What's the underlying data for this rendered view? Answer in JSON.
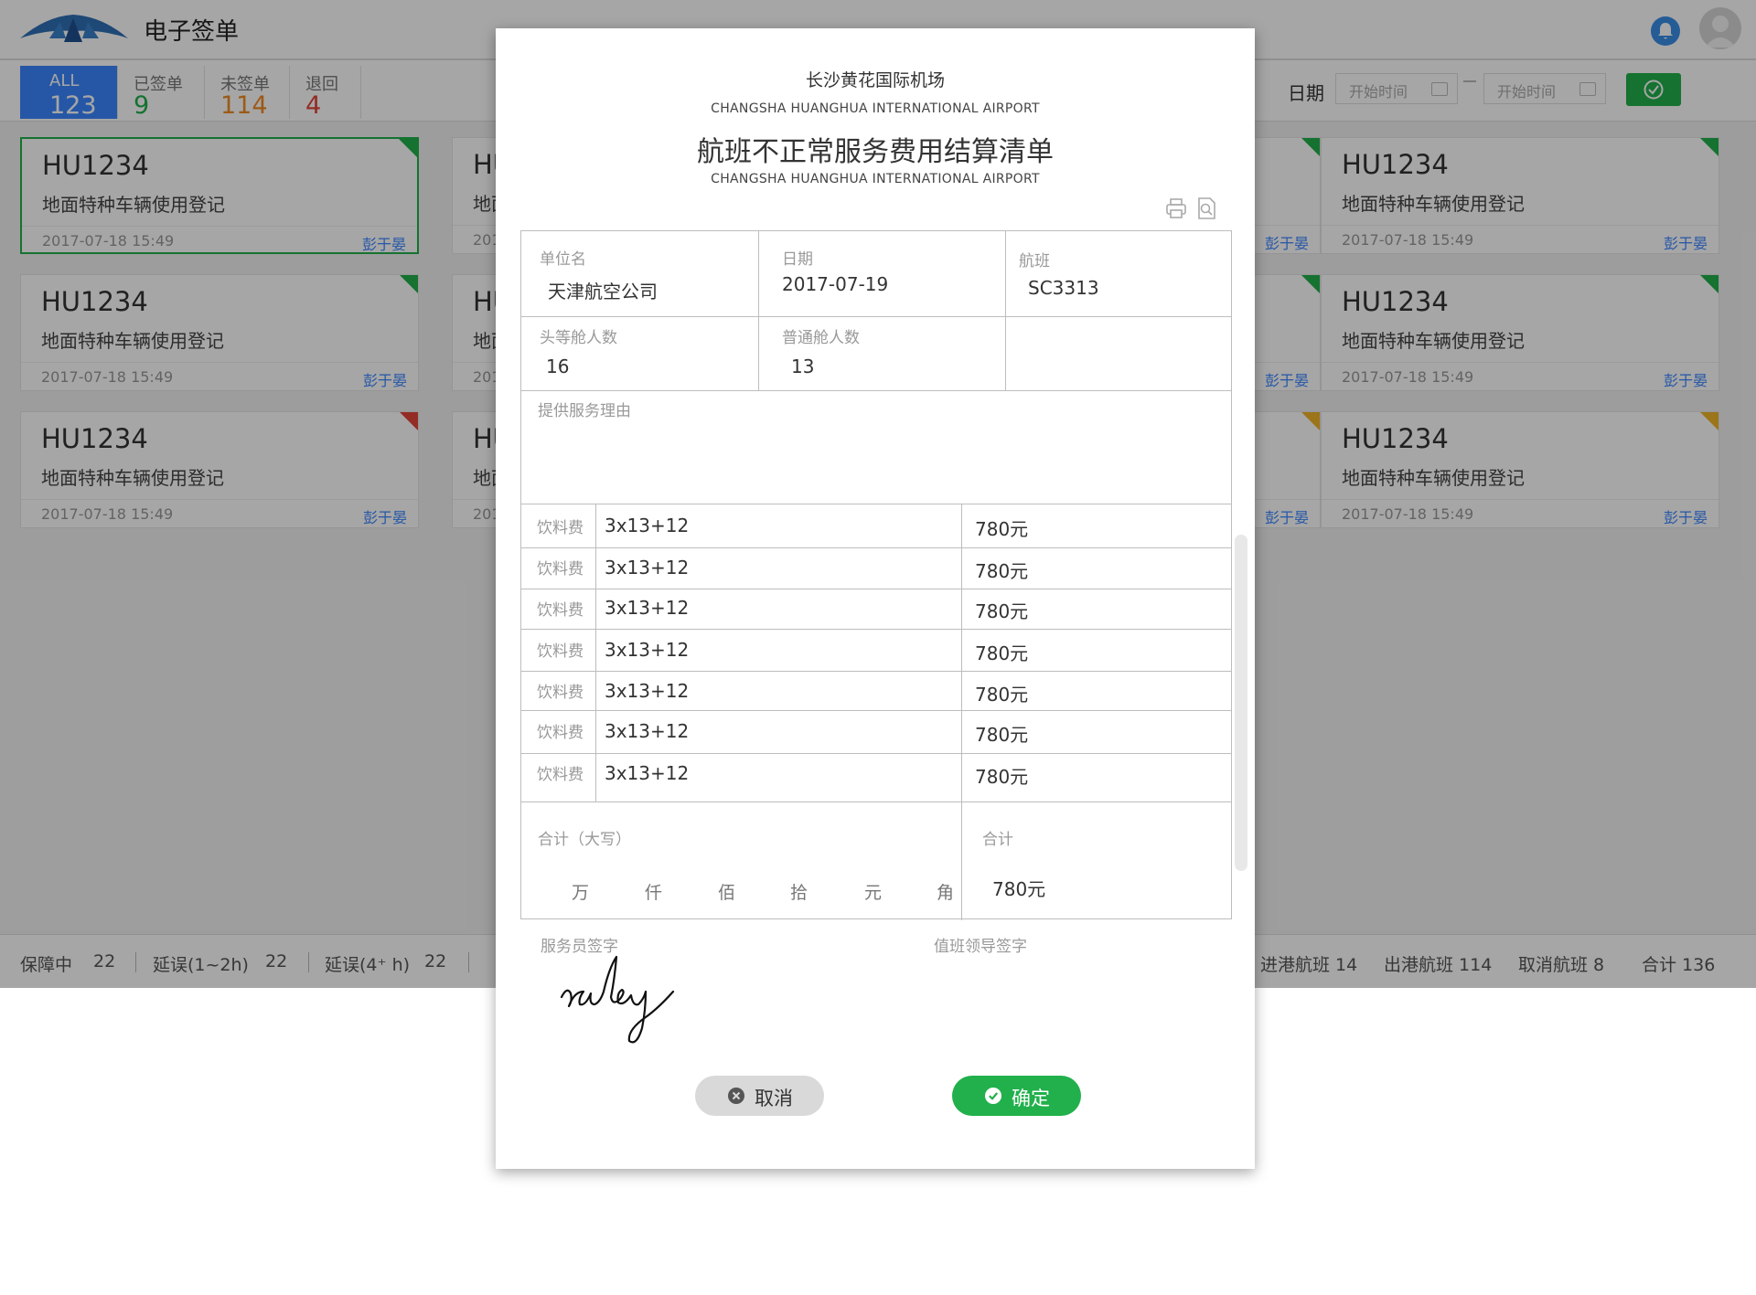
{
  "app": {
    "title": "电子签单"
  },
  "tabs": [
    {
      "label": "ALL",
      "count": "123",
      "color": "#ffffff"
    },
    {
      "label": "已签单",
      "count": "9",
      "color": "#21b04b"
    },
    {
      "label": "未签单",
      "count": "114",
      "color": "#f08a24"
    },
    {
      "label": "退回",
      "count": "4",
      "color": "#e2443a"
    }
  ],
  "date_filter": {
    "label": "日期",
    "start_placeholder": "开始时间",
    "end_placeholder": "开始时间"
  },
  "cards": [
    {
      "flight": "HU1234",
      "desc": "地面特种车辆使用登记",
      "time": "2017-07-18 15:49",
      "user": "彭于晏",
      "corner_color": "#21b04b"
    },
    {
      "flight": "HU1234",
      "desc": "地面特种车辆使用登记",
      "time": "2017-07-18 15:49",
      "user": "彭于晏",
      "corner_color": "#21b04b"
    },
    {
      "flight": "HU1234",
      "desc": "地面特种车辆使用登记",
      "time": "2017-07-18 15:49",
      "user": "彭于晏",
      "corner_color": "#21b04b"
    },
    {
      "flight": "HU1234",
      "desc": "地面特种车辆使用登记",
      "time": "2017-07-18 15:49",
      "user": "彭于晏",
      "corner_color": "#21b04b"
    },
    {
      "flight": "HU1234",
      "desc": "地面特种车辆使用登记",
      "time": "2017-07-18 15:49",
      "user": "彭于晏",
      "corner_color": "#21b04b"
    },
    {
      "flight": "HU1234",
      "desc": "地面特种车辆使用登记",
      "time": "2017-07-18 15:49",
      "user": "彭于晏",
      "corner_color": "#21b04b"
    },
    {
      "flight": "HU1234",
      "desc": "地面特种车辆使用登记",
      "time": "2017-07-18 15:49",
      "user": "彭于晏",
      "corner_color": "#21b04b"
    },
    {
      "flight": "HU1234",
      "desc": "地面特种车辆使用登记",
      "time": "2017-07-18 15:49",
      "user": "彭于晏",
      "corner_color": "#21b04b"
    },
    {
      "flight": "HU1234",
      "desc": "地面特种车辆使用登记",
      "time": "2017-07-18 15:49",
      "user": "彭于晏",
      "corner_color": "#e2443a"
    },
    {
      "flight": "HU1234",
      "desc": "地面特种车辆使用登记",
      "time": "2017-07-18 15:49",
      "user": "彭于晏",
      "corner_color": "#e2443a"
    },
    {
      "flight": "HU1234",
      "desc": "地面特种车辆使用登记",
      "time": "2017-07-18 15:49",
      "user": "彭于晏",
      "corner_color": "#f0b429"
    },
    {
      "flight": "HU1234",
      "desc": "地面特种车辆使用登记",
      "time": "2017-07-18 15:49",
      "user": "彭于晏",
      "corner_color": "#f0b429"
    }
  ],
  "statusbar": {
    "items": [
      {
        "label": "保障中",
        "value": "22"
      },
      {
        "label": "延误(1~2h)",
        "value": "22"
      },
      {
        "label": "延误(4⁺ h)",
        "value": "22"
      }
    ],
    "right_items": [
      "进港航班 14",
      "出港航班 114",
      "取消航班 8",
      "合计 136"
    ]
  },
  "modal": {
    "airport_cn": "长沙黄花国际机场",
    "airport_en": "CHANGSHA HUANGHUA INTERNATIONAL AIRPORT",
    "title": "航班不正常服务费用结算清单",
    "subtitle_en": "CHANGSHA HUANGHUA INTERNATIONAL AIRPORT",
    "fields": {
      "company_label": "单位名",
      "company_value": "天津航空公司",
      "date_label": "日期",
      "date_value": "2017-07-19",
      "flight_label": "航班",
      "flight_value": "SC3313",
      "first_class_label": "头等舱人数",
      "first_class_value": "16",
      "economy_label": "普通舱人数",
      "economy_value": "13",
      "reason_label": "提供服务理由"
    },
    "fees": [
      {
        "label": "饮料费",
        "formula": "3x13+12",
        "amount": "780元"
      },
      {
        "label": "饮料费",
        "formula": "3x13+12",
        "amount": "780元"
      },
      {
        "label": "饮料费",
        "formula": "3x13+12",
        "amount": "780元"
      },
      {
        "label": "饮料费",
        "formula": "3x13+12",
        "amount": "780元"
      },
      {
        "label": "饮料费",
        "formula": "3x13+12",
        "amount": "780元"
      },
      {
        "label": "饮料费",
        "formula": "3x13+12",
        "amount": "780元"
      },
      {
        "label": "饮料费",
        "formula": "3x13+12",
        "amount": "780元"
      }
    ],
    "total_caps_label": "合计（大写）",
    "units": [
      "万",
      "仟",
      "佰",
      "拾",
      "元",
      "角"
    ],
    "total_label": "合计",
    "total_value": "780元",
    "attendant_sign_label": "服务员签字",
    "leader_sign_label": "值班领导签字",
    "signature_text": "ruby",
    "cancel_label": "取消",
    "confirm_label": "确定"
  },
  "colors": {
    "accent": "#3b86ff",
    "success": "#21b04b",
    "warning": "#f08a24",
    "danger": "#e2443a"
  }
}
